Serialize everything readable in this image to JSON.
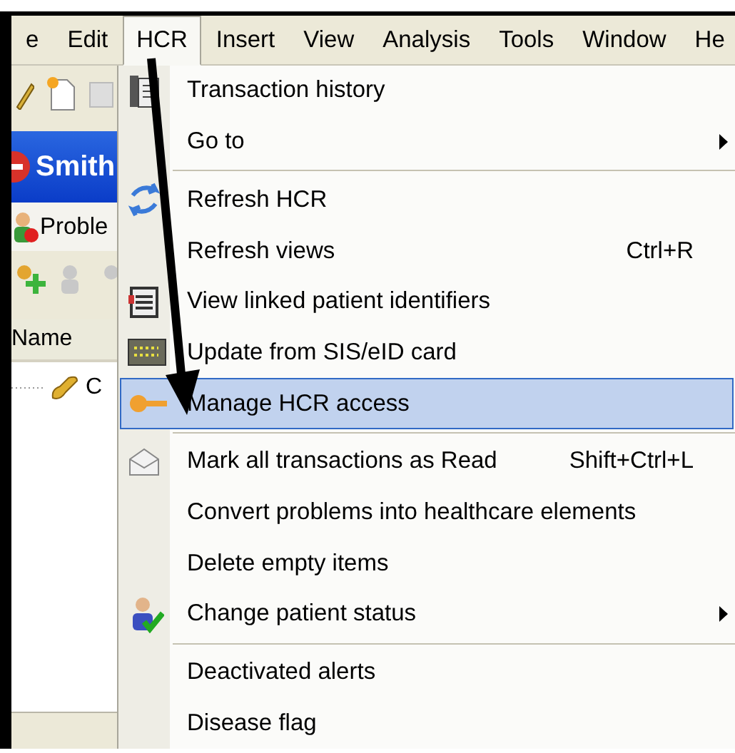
{
  "menubar": [
    {
      "label": "e",
      "selected": false
    },
    {
      "label": "Edit",
      "selected": false
    },
    {
      "label": "HCR",
      "selected": true
    },
    {
      "label": "Insert",
      "selected": false
    },
    {
      "label": "View",
      "selected": false
    },
    {
      "label": "Analysis",
      "selected": false
    },
    {
      "label": "Tools",
      "selected": false
    },
    {
      "label": "Window",
      "selected": false
    },
    {
      "label": "He",
      "selected": false
    }
  ],
  "left_panel": {
    "patient_name": "Smith",
    "tab": "Proble",
    "column_header": "Name",
    "tree_row": "C"
  },
  "menu": [
    {
      "kind": "item",
      "label": "Transaction history",
      "selected": false
    },
    {
      "kind": "item",
      "label": "Go to",
      "submenu": true,
      "selected": false
    },
    {
      "kind": "separator"
    },
    {
      "kind": "item",
      "label": "Refresh HCR",
      "selected": false
    },
    {
      "kind": "item",
      "label": "Refresh views",
      "shortcut": "Ctrl+R",
      "selected": false
    },
    {
      "kind": "item",
      "label": "View linked patient identifiers",
      "selected": false
    },
    {
      "kind": "item",
      "label": "Update from SIS/eID card",
      "selected": false
    },
    {
      "kind": "item",
      "label": "Manage HCR access",
      "selected": true
    },
    {
      "kind": "separator"
    },
    {
      "kind": "item",
      "label": "Mark all transactions as Read",
      "shortcut": "Shift+Ctrl+L",
      "selected": false
    },
    {
      "kind": "item",
      "label": "Convert problems into healthcare elements",
      "selected": false
    },
    {
      "kind": "item",
      "label": "Delete empty items",
      "selected": false
    },
    {
      "kind": "item",
      "label": "Change patient status",
      "submenu": true,
      "selected": false
    },
    {
      "kind": "separator"
    },
    {
      "kind": "item",
      "label": "Deactivated alerts",
      "selected": false
    },
    {
      "kind": "item",
      "label": "Disease flag",
      "selected": false
    }
  ]
}
